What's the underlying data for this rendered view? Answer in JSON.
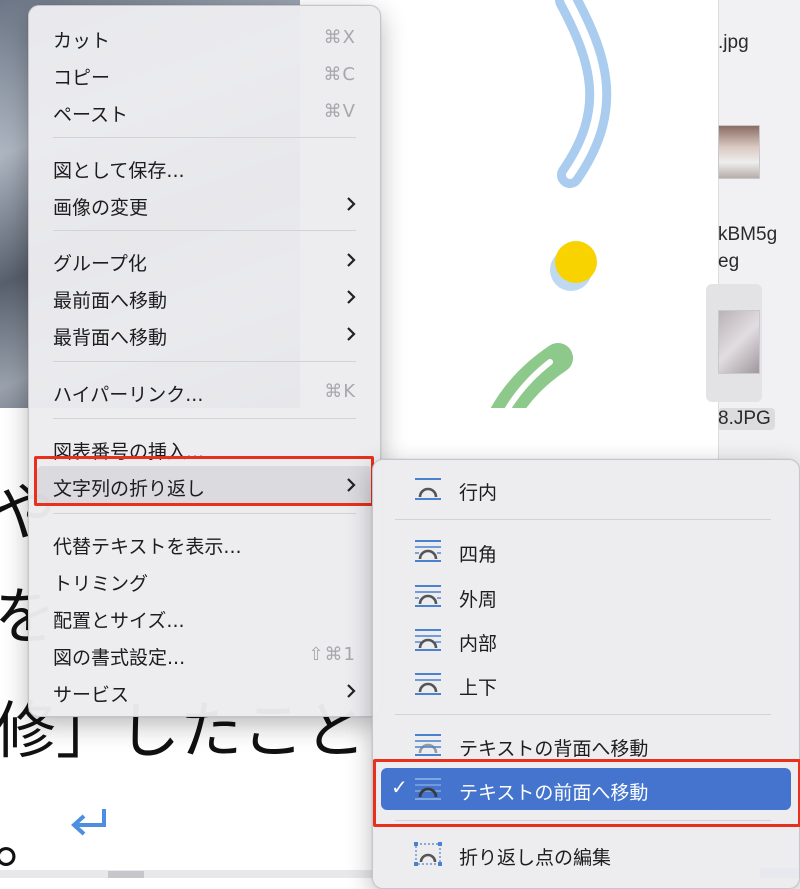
{
  "document": {
    "lines": [
      "や",
      "を",
      "修」したこと",
      "。"
    ],
    "files": [
      ".jpg",
      "kBM5g",
      "eg",
      "8.JPG"
    ]
  },
  "context_menu": {
    "items": [
      {
        "label": "カット",
        "shortcut": "⌘X"
      },
      {
        "label": "コピー",
        "shortcut": "⌘C"
      },
      {
        "label": "ペースト",
        "shortcut": "⌘V"
      },
      {
        "label": "図として保存..."
      },
      {
        "label": "画像の変更",
        "submenu": true
      },
      {
        "label": "グループ化",
        "submenu": true
      },
      {
        "label": "最前面へ移動",
        "submenu": true
      },
      {
        "label": "最背面へ移動",
        "submenu": true
      },
      {
        "label": "ハイパーリンク...",
        "shortcut": "⌘K"
      },
      {
        "label": "図表番号の挿入..."
      },
      {
        "label": "文字列の折り返し",
        "submenu": true,
        "highlighted": true
      },
      {
        "label": "代替テキストを表示..."
      },
      {
        "label": "トリミング"
      },
      {
        "label": "配置とサイズ..."
      },
      {
        "label": "図の書式設定...",
        "shortcut": "⇧⌘1"
      },
      {
        "label": "サービス",
        "submenu": true
      }
    ]
  },
  "wrap_submenu": {
    "items": [
      {
        "label": "行内",
        "icon": "inline-wrap-icon"
      },
      {
        "label": "四角",
        "icon": "square-wrap-icon"
      },
      {
        "label": "外周",
        "icon": "tight-wrap-icon"
      },
      {
        "label": "内部",
        "icon": "through-wrap-icon"
      },
      {
        "label": "上下",
        "icon": "top-bottom-wrap-icon"
      },
      {
        "label": "テキストの背面へ移動",
        "icon": "behind-text-icon"
      },
      {
        "label": "テキストの前面へ移動",
        "icon": "in-front-of-text-icon",
        "checked": true,
        "check_mark": "✓"
      },
      {
        "label": "折り返し点の編集",
        "icon": "edit-wrap-points-icon"
      }
    ]
  },
  "colors": {
    "menu_bg": "#ececf0",
    "selected_bg": "#4474ce",
    "highlight_border": "#e8301c",
    "icon_blue": "#4a82d0",
    "icon_arc": "#555555"
  }
}
